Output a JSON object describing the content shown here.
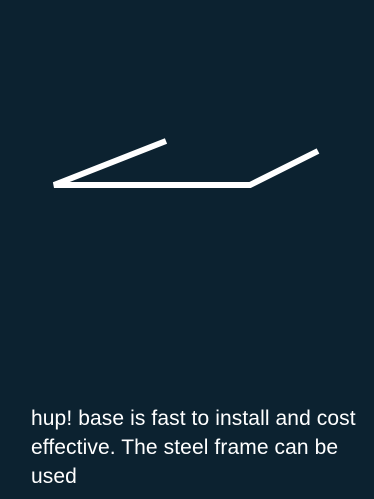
{
  "hero": {
    "icon": "steel-frame-outline-icon",
    "line_color": "#ffffff",
    "background_color": "#0c2230"
  },
  "content": {
    "description": "hup! base is fast to install and cost effective. The steel frame can be used"
  }
}
